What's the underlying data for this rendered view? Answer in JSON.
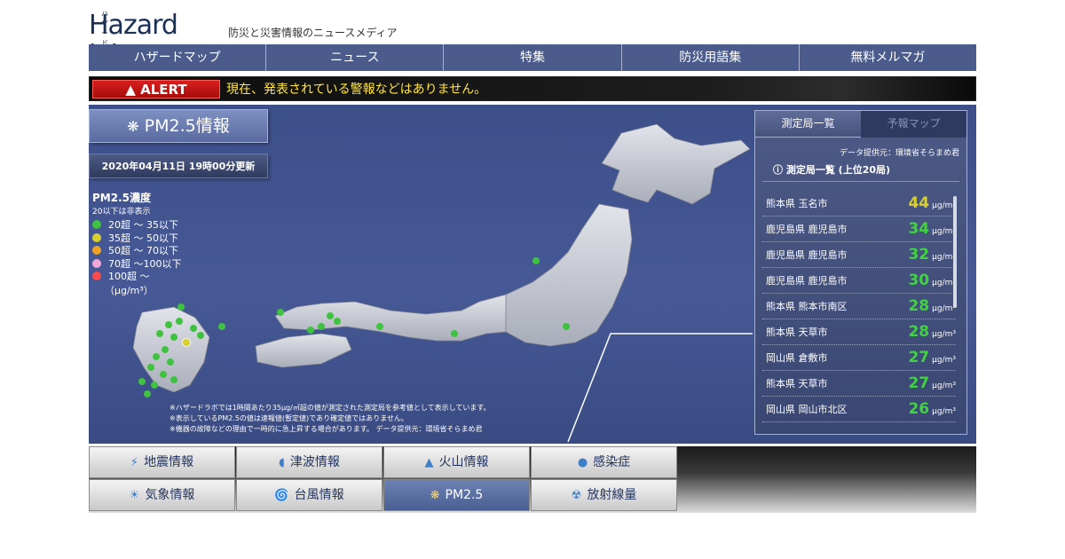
{
  "header": {
    "logo_kana": "ハザードラボ",
    "logo_text": "Hazard lab",
    "tagline": "防災と災害情報のニュースメディア"
  },
  "nav": [
    "ハザードマップ",
    "ニュース",
    "特集",
    "防災用語集",
    "無料メルマガ"
  ],
  "alert": {
    "badge": "ALERT",
    "message": "現在、発表されている警報などはありません。"
  },
  "pm": {
    "title": "PM2.5情報",
    "updated": "2020年04月11日 19時00分更新"
  },
  "legend": {
    "title": "PM2.5濃度",
    "subtitle": "20以下は非表示",
    "items": [
      {
        "label": "20超 〜  35以下",
        "color": "#3fc23f"
      },
      {
        "label": "35超 〜  50以下",
        "color": "#d7cf2e"
      },
      {
        "label": "50超 〜  70以下",
        "color": "#f0a226"
      },
      {
        "label": "70超 〜100以下",
        "color": "#f0a6d6"
      },
      {
        "label": "100超 〜",
        "color": "#ff4b4b"
      }
    ],
    "unit": "（μg/m³）"
  },
  "notes": [
    "※ハザードラボでは1時間あたり35μg/㎥超の値が測定された測定局を参考値として表示しています。",
    "※表示しているPM2.5の値は速報値(暫定値)であり確定値ではありません。",
    "※機器の故障などの理由で一時的に急上昇する場合があります。 データ提供元：環境省そらまめ君"
  ],
  "panel": {
    "tab_active": "測定局一覧",
    "tab_inactive": "予報マップ",
    "source": "データ提供元：環境省そらまめ君",
    "heading": "測定局一覧 (上位20局)",
    "unit": "μg/m³",
    "stations": [
      {
        "name": "熊本県 玉名市",
        "value": "44",
        "color": "#d7cf2e"
      },
      {
        "name": "鹿児島県 鹿児島市",
        "value": "34",
        "color": "#3fd43f"
      },
      {
        "name": "鹿児島県 鹿児島市",
        "value": "32",
        "color": "#3fd43f"
      },
      {
        "name": "鹿児島県 鹿児島市",
        "value": "30",
        "color": "#3fd43f"
      },
      {
        "name": "熊本県 熊本市南区",
        "value": "28",
        "color": "#3fd43f"
      },
      {
        "name": "熊本県 天草市",
        "value": "28",
        "color": "#3fd43f"
      },
      {
        "name": "岡山県 倉敷市",
        "value": "27",
        "color": "#3fd43f"
      },
      {
        "name": "熊本県 天草市",
        "value": "27",
        "color": "#3fd43f"
      },
      {
        "name": "岡山県 岡山市北区",
        "value": "26",
        "color": "#3fd43f"
      }
    ]
  },
  "menu": [
    {
      "label": "地震情報",
      "icon": "quake-icon",
      "glyph": "⚡",
      "active": false
    },
    {
      "label": "津波情報",
      "icon": "tsunami-icon",
      "glyph": "◖",
      "active": false
    },
    {
      "label": "火山情報",
      "icon": "volcano-icon",
      "glyph": "▲",
      "active": false
    },
    {
      "label": "感染症",
      "icon": "virus-icon",
      "glyph": "●",
      "active": false
    },
    {
      "label": "気象情報",
      "icon": "sun-icon",
      "glyph": "☀",
      "active": false
    },
    {
      "label": "台風情報",
      "icon": "typhoon-icon",
      "glyph": "🌀",
      "active": false
    },
    {
      "label": "PM2.5",
      "icon": "pm25-icon",
      "glyph": "❋",
      "active": true
    },
    {
      "label": "放射線量",
      "icon": "radiation-icon",
      "glyph": "☢",
      "active": false
    }
  ],
  "colors": {
    "nav_bg": "#4a5b8c",
    "map_bg": "#465996",
    "alert_text": "#ffe54a",
    "alert_badge": "#d91e1e"
  }
}
